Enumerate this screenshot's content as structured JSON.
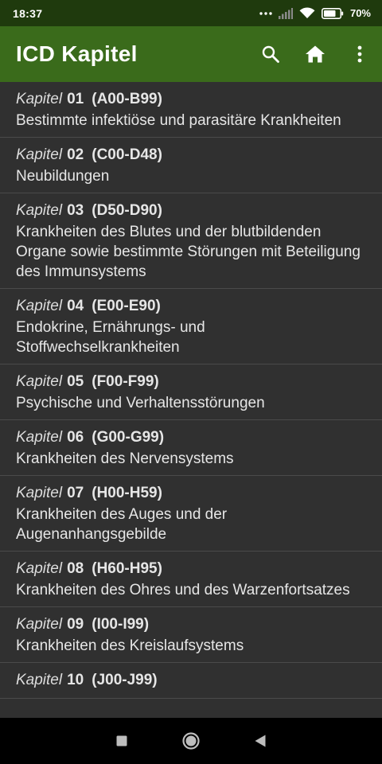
{
  "status": {
    "time": "18:37",
    "battery": "70%"
  },
  "app_bar": {
    "title": "ICD Kapitel",
    "actions": [
      {
        "name": "search-button",
        "icon": "search-icon"
      },
      {
        "name": "home-button",
        "icon": "home-icon"
      },
      {
        "name": "more-options-button",
        "icon": "more-vert-icon"
      }
    ]
  },
  "chapters": [
    {
      "kapitel": "Kapitel",
      "num": "01",
      "range": "(A00-B99)",
      "title": "Bestimmte infektiöse und parasitäre Krankheiten"
    },
    {
      "kapitel": "Kapitel",
      "num": "02",
      "range": "(C00-D48)",
      "title": "Neubildungen"
    },
    {
      "kapitel": "Kapitel",
      "num": "03",
      "range": "(D50-D90)",
      "title": "Krankheiten des Blutes und der blutbildenden Organe sowie bestimmte Störungen mit Beteiligung des Immunsystems"
    },
    {
      "kapitel": "Kapitel",
      "num": "04",
      "range": "(E00-E90)",
      "title": "Endokrine, Ernährungs- und Stoffwechselkrankheiten"
    },
    {
      "kapitel": "Kapitel",
      "num": "05",
      "range": "(F00-F99)",
      "title": "Psychische und Verhaltensstörungen"
    },
    {
      "kapitel": "Kapitel",
      "num": "06",
      "range": "(G00-G99)",
      "title": "Krankheiten des Nervensystems"
    },
    {
      "kapitel": "Kapitel",
      "num": "07",
      "range": "(H00-H59)",
      "title": "Krankheiten des Auges und der Augenanhangsgebilde"
    },
    {
      "kapitel": "Kapitel",
      "num": "08",
      "range": "(H60-H95)",
      "title": "Krankheiten des Ohres und des Warzenfortsatzes"
    },
    {
      "kapitel": "Kapitel",
      "num": "09",
      "range": "(I00-I99)",
      "title": "Krankheiten des Kreislaufsystems"
    },
    {
      "kapitel": "Kapitel",
      "num": "10",
      "range": "(J00-J99)",
      "title": ""
    }
  ],
  "colors": {
    "status_bar": "#1f3a0d",
    "app_bar": "#3a6b1b",
    "list_bg": "#303030",
    "divider": "#4a4a4a",
    "text": "#e6e6e6"
  }
}
